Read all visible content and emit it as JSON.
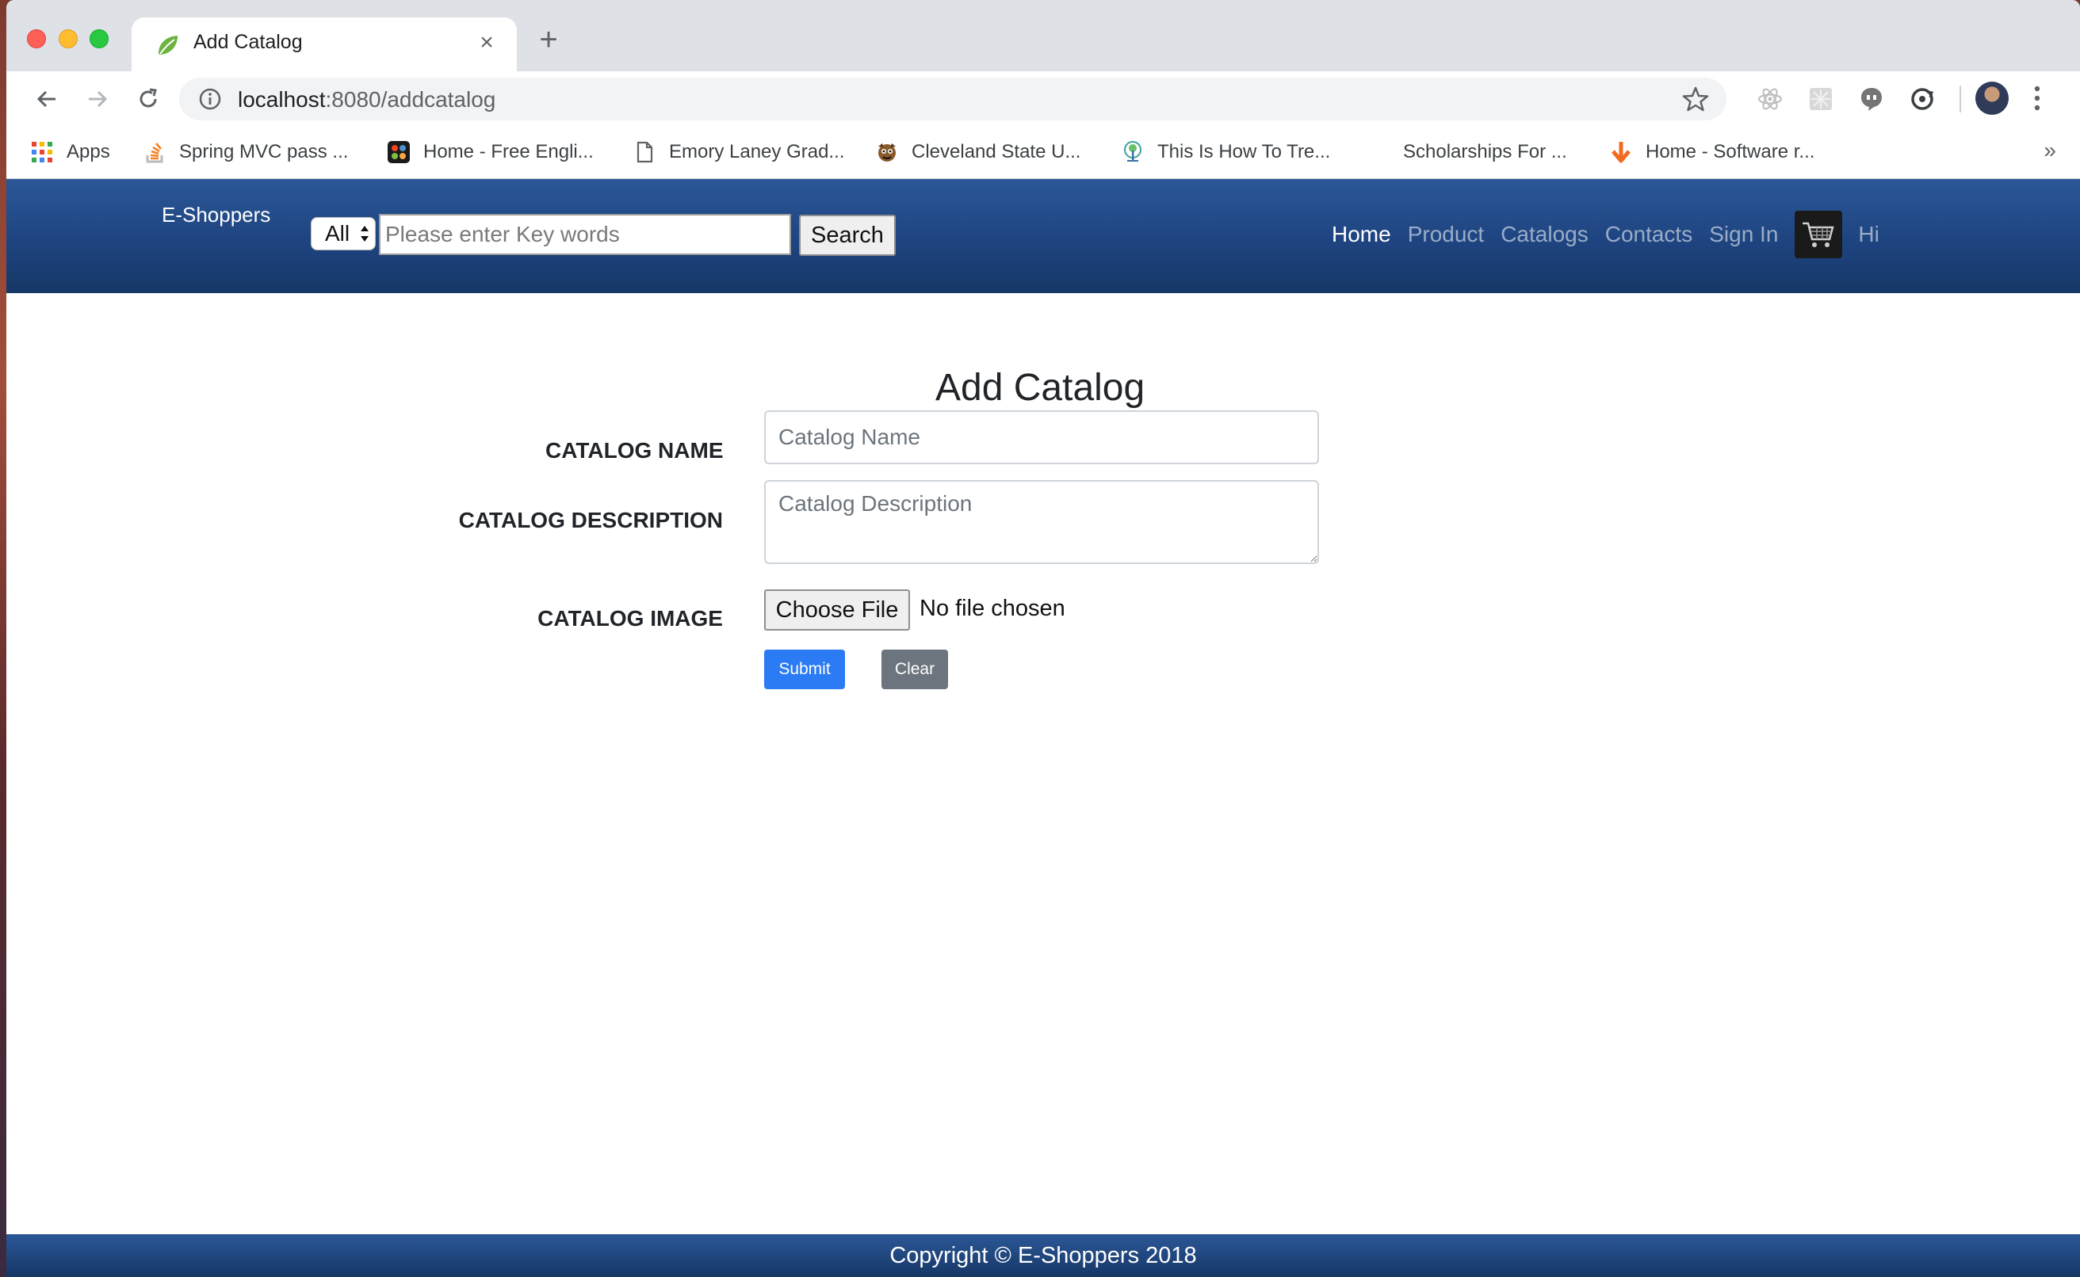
{
  "browser": {
    "tab": {
      "title": "Add Catalog",
      "close": "×",
      "favicon": "spring-leaf-icon"
    },
    "new_tab": "+",
    "url": {
      "host": "localhost",
      "path": ":8080/addcatalog"
    },
    "bookmarks": [
      {
        "label": "Apps",
        "icon": "apps-grid-icon"
      },
      {
        "label": "Spring MVC pass ...",
        "icon": "stackoverflow-icon"
      },
      {
        "label": "Home - Free Engli...",
        "icon": "joomla-icon"
      },
      {
        "label": "Emory Laney Grad...",
        "icon": "page-icon"
      },
      {
        "label": "Cleveland State U...",
        "icon": "mascot-icon"
      },
      {
        "label": "This Is How To Tre...",
        "icon": "tree-icon"
      },
      {
        "label": "Scholarships For ...",
        "icon": ""
      },
      {
        "label": "Home - Software r...",
        "icon": "arrow-down-icon"
      }
    ],
    "bookmarks_more": "»"
  },
  "site": {
    "brand": "E-Shoppers",
    "category_select": "All",
    "search_placeholder": "Please enter Key words",
    "search_button": "Search",
    "nav": {
      "home": "Home",
      "product": "Product",
      "catalogs": "Catalogs",
      "contacts": "Contacts",
      "sign_in": "Sign In",
      "greeting": "Hi"
    }
  },
  "form": {
    "title": "Add Catalog",
    "name_label": "CATALOG NAME",
    "name_placeholder": "Catalog Name",
    "description_label": "CATALOG DESCRIPTION",
    "description_placeholder": "Catalog Description",
    "image_label": "CATALOG IMAGE",
    "choose_file": "Choose File",
    "file_status": "No file chosen",
    "submit": "Submit",
    "clear": "Clear"
  },
  "footer": {
    "copyright": "Copyright © E-Shoppers 2018"
  },
  "colors": {
    "navbar": "#1e4480",
    "submit": "#2a7bf4",
    "clear": "#6c757d"
  }
}
